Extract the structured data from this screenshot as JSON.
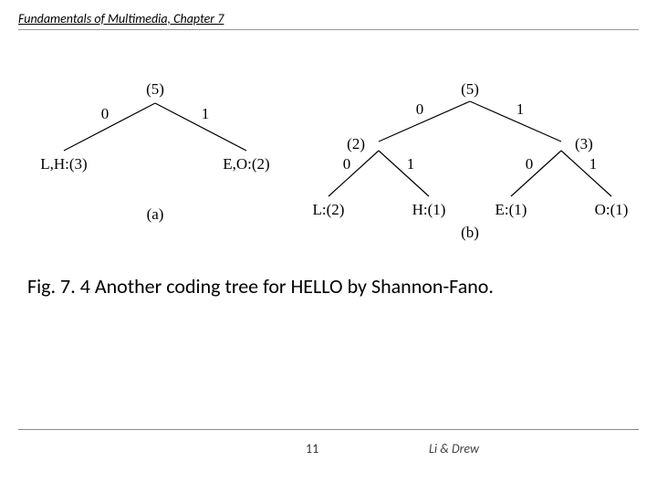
{
  "header": {
    "title": "Fundamentals of Multimedia, Chapter 7"
  },
  "caption": "Fig. 7. 4 Another coding tree for HELLO by Shannon-Fano.",
  "footer": {
    "page": "11",
    "authors": "Li & Drew"
  },
  "treeA": {
    "sublabel": "(a)",
    "root": "(5)",
    "left_edge": "0",
    "right_edge": "1",
    "left_leaf": "L,H:(3)",
    "right_leaf": "E,O:(2)"
  },
  "treeB": {
    "sublabel": "(b)",
    "root": "(5)",
    "left_node": "(2)",
    "right_node": "(3)",
    "root_left_edge": "0",
    "root_right_edge": "1",
    "ll_edge": "0",
    "lr_edge": "1",
    "rl_edge": "0",
    "rr_edge": "1",
    "leaf_ll": "L:(2)",
    "leaf_lr": "H:(1)",
    "leaf_rl": "E:(1)",
    "leaf_rr": "O:(1)"
  }
}
